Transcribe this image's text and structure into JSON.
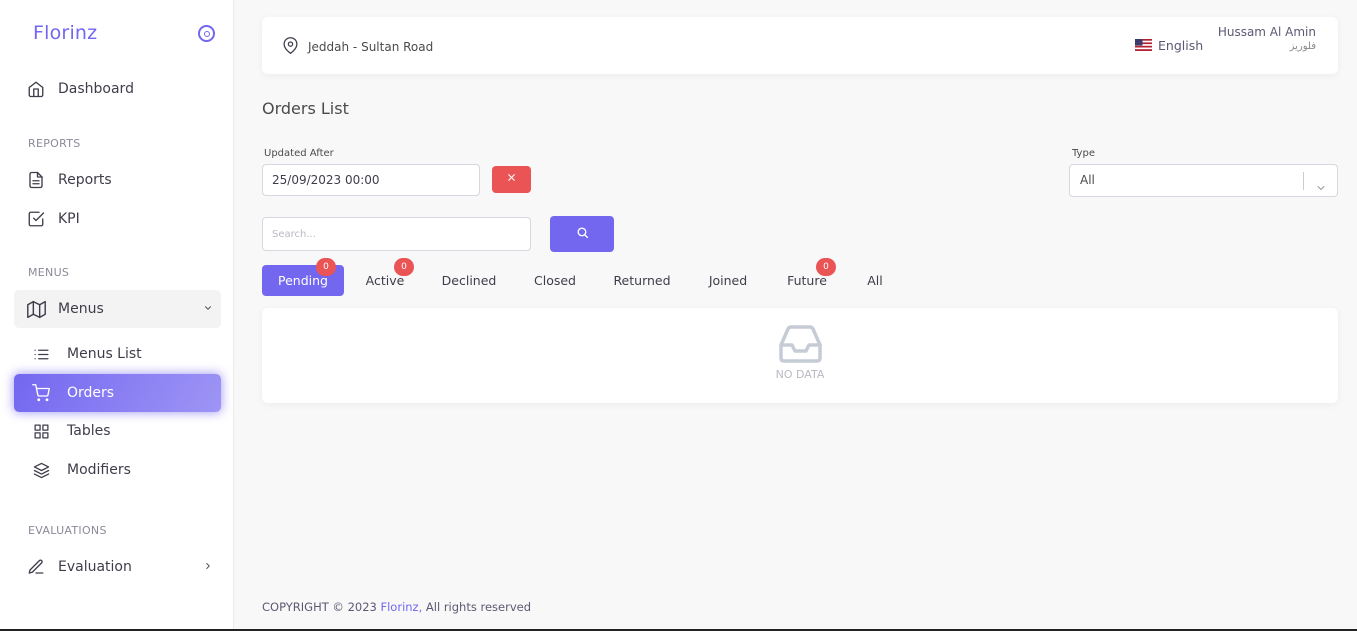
{
  "sidebar": {
    "brand": "Florinz",
    "sections": {
      "reports": "REPORTS",
      "menus": "MENUS",
      "evaluations": "EVALUATIONS"
    },
    "items": {
      "dashboard": "Dashboard",
      "reports": "Reports",
      "kpi": "KPI",
      "menus": "Menus",
      "menus_list": "Menus List",
      "orders": "Orders",
      "tables": "Tables",
      "modifiers": "Modifiers",
      "evaluation": "Evaluation"
    }
  },
  "navbar": {
    "location": "Jeddah - Sultan Road",
    "language": "English",
    "user_name": "Hussam Al Amin",
    "user_sub": "فلوريز"
  },
  "main": {
    "title": "Orders List",
    "filters": {
      "updated_after_label": "Updated After",
      "updated_after_value": "25/09/2023  00:00",
      "type_label": "Type",
      "type_value": "All",
      "search_placeholder": "Search..."
    },
    "tabs": [
      {
        "label": "Pending",
        "badge": "0"
      },
      {
        "label": "Active",
        "badge": "0"
      },
      {
        "label": "Declined"
      },
      {
        "label": "Closed"
      },
      {
        "label": "Returned"
      },
      {
        "label": "Joined"
      },
      {
        "label": "Future",
        "badge": "0"
      },
      {
        "label": "All"
      }
    ],
    "empty_text": "NO DATA"
  },
  "footer": {
    "copyright": "COPYRIGHT © 2023 ",
    "brand": "Florinz,",
    "rights": " All rights reserved"
  },
  "colors": {
    "primary": "#7367f0",
    "danger": "#ea5455"
  }
}
